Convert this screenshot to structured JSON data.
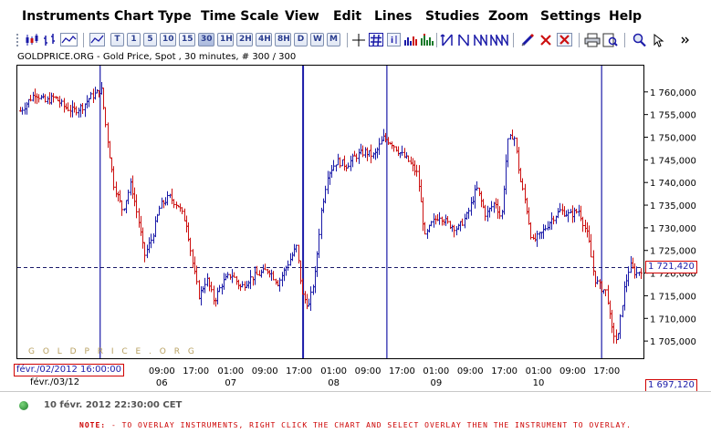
{
  "menu": [
    "Instruments",
    "Chart Type",
    "Time Scale",
    "View",
    "Edit",
    "Lines",
    "Studies",
    "Zoom",
    "Settings",
    "Help"
  ],
  "toolbar": {
    "periods": [
      "T",
      "1",
      "5",
      "10",
      "15",
      "30",
      "1H",
      "2H",
      "4H",
      "8H",
      "D",
      "W",
      "M"
    ],
    "selected_period": "30"
  },
  "chart": {
    "subtitle": "GOLDPRICE.ORG - Gold Price, Spot , 30 minutes, # 300 / 300",
    "watermark": "G O L D P R I C E . O R G",
    "current_price_label": "1 721,420",
    "min_price_label": "1 697,120",
    "cursor_date_label": "févr./02/2012 16:00:00",
    "start_date_label": "févr./03/12",
    "status_time": "10 févr. 2012 22:30:00 CET"
  },
  "note": {
    "label": "NOTE:",
    "text": "- TO OVERLAY INSTRUMENTS, RIGHT CLICK THE CHART AND SELECT OVERLAY THEN THE INSTRUMENT TO OVERLAY."
  },
  "colors": {
    "up_candle": "#1a1aa8",
    "down_candle": "#cc1010",
    "session_line": "#1a1aa8",
    "price_line": "#1a1a6a",
    "watermark": "#b8a060"
  },
  "chart_data": {
    "type": "ohlc",
    "ylim": [
      1701.0,
      1766.0
    ],
    "yticks": [
      "1 705,000",
      "1 710,000",
      "1 715,000",
      "1 720,000",
      "1 725,000",
      "1 730,000",
      "1 735,000",
      "1 740,000",
      "1 745,000",
      "1 750,000",
      "1 755,000",
      "1 760,000"
    ],
    "ytick_values": [
      1705,
      1710,
      1715,
      1720,
      1725,
      1730,
      1735,
      1740,
      1745,
      1750,
      1755,
      1760
    ],
    "xticks": [
      "09:00",
      "17:00",
      "01:00",
      "09:00",
      "17:00",
      "01:00",
      "09:00",
      "17:00",
      "01:00",
      "09:00",
      "17:00",
      "01:00",
      "09:00",
      "17:00"
    ],
    "xtick_positions": [
      0.271,
      0.326,
      0.382,
      0.437,
      0.492,
      0.548,
      0.603,
      0.658,
      0.713,
      0.768,
      0.823,
      0.878,
      0.933,
      0.988
    ],
    "day_labels": [
      "06",
      "07",
      "08",
      "09",
      "10"
    ],
    "day_positions": [
      0.271,
      0.382,
      0.548,
      0.713,
      0.878
    ],
    "session_lines": [
      0.129,
      0.456,
      0.591,
      0.937
    ],
    "current_price": 1721.42,
    "path": [
      [
        0.0,
        1756
      ],
      [
        0.012,
        1758
      ],
      [
        0.024,
        1760
      ],
      [
        0.04,
        1758
      ],
      [
        0.055,
        1759
      ],
      [
        0.07,
        1757
      ],
      [
        0.085,
        1756
      ],
      [
        0.1,
        1757
      ],
      [
        0.112,
        1759
      ],
      [
        0.124,
        1760
      ],
      [
        0.13,
        1761
      ],
      [
        0.138,
        1752
      ],
      [
        0.15,
        1740
      ],
      [
        0.165,
        1734
      ],
      [
        0.178,
        1740
      ],
      [
        0.19,
        1732
      ],
      [
        0.2,
        1724
      ],
      [
        0.212,
        1728
      ],
      [
        0.225,
        1735
      ],
      [
        0.24,
        1737
      ],
      [
        0.255,
        1735
      ],
      [
        0.268,
        1731
      ],
      [
        0.278,
        1722
      ],
      [
        0.288,
        1715
      ],
      [
        0.3,
        1719
      ],
      [
        0.312,
        1714
      ],
      [
        0.325,
        1718
      ],
      [
        0.34,
        1720
      ],
      [
        0.355,
        1717
      ],
      [
        0.37,
        1719
      ],
      [
        0.385,
        1720
      ],
      [
        0.4,
        1721
      ],
      [
        0.415,
        1718
      ],
      [
        0.43,
        1722
      ],
      [
        0.445,
        1726
      ],
      [
        0.455,
        1715
      ],
      [
        0.465,
        1713
      ],
      [
        0.475,
        1720
      ],
      [
        0.485,
        1734
      ],
      [
        0.495,
        1742
      ],
      [
        0.51,
        1745
      ],
      [
        0.525,
        1744
      ],
      [
        0.54,
        1746
      ],
      [
        0.555,
        1747
      ],
      [
        0.57,
        1746
      ],
      [
        0.585,
        1750
      ],
      [
        0.598,
        1749
      ],
      [
        0.61,
        1747
      ],
      [
        0.625,
        1745
      ],
      [
        0.64,
        1742
      ],
      [
        0.652,
        1728
      ],
      [
        0.662,
        1731
      ],
      [
        0.675,
        1733
      ],
      [
        0.69,
        1731
      ],
      [
        0.705,
        1730
      ],
      [
        0.72,
        1733
      ],
      [
        0.735,
        1739
      ],
      [
        0.75,
        1733
      ],
      [
        0.765,
        1736
      ],
      [
        0.775,
        1732
      ],
      [
        0.785,
        1749
      ],
      [
        0.795,
        1751
      ],
      [
        0.805,
        1741
      ],
      [
        0.815,
        1735
      ],
      [
        0.825,
        1727
      ],
      [
        0.84,
        1729
      ],
      [
        0.855,
        1732
      ],
      [
        0.87,
        1734
      ],
      [
        0.885,
        1733
      ],
      [
        0.9,
        1734
      ],
      [
        0.915,
        1728
      ],
      [
        0.925,
        1719
      ],
      [
        0.935,
        1717
      ],
      [
        0.945,
        1716
      ],
      [
        0.952,
        1708
      ],
      [
        0.962,
        1705
      ],
      [
        0.972,
        1716
      ],
      [
        0.982,
        1722
      ],
      [
        0.992,
        1720
      ],
      [
        1.0,
        1721
      ]
    ],
    "xlabel": "",
    "ylabel": ""
  }
}
